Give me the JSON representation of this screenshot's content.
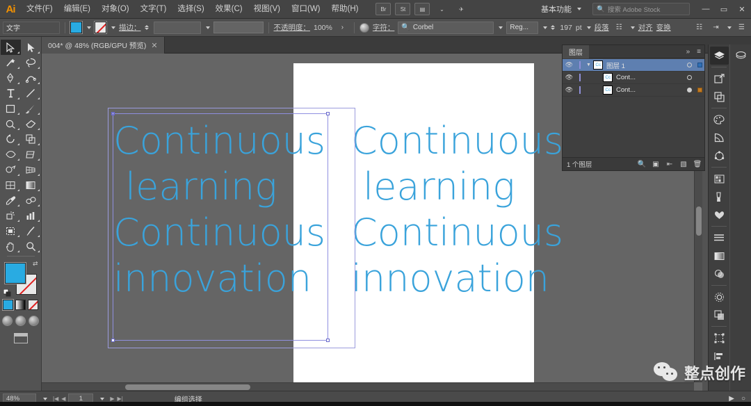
{
  "app": {
    "logo": "Ai",
    "title": "Adobe Illustrator"
  },
  "menubar": {
    "items": [
      {
        "label": "文件(F)"
      },
      {
        "label": "编辑(E)"
      },
      {
        "label": "对象(O)"
      },
      {
        "label": "文字(T)"
      },
      {
        "label": "选择(S)"
      },
      {
        "label": "效果(C)"
      },
      {
        "label": "视图(V)"
      },
      {
        "label": "窗口(W)"
      },
      {
        "label": "帮助(H)"
      }
    ],
    "bridge_icon": "bridge-icon",
    "stock_icon": "St",
    "arrange_icon": "arrange-documents-icon",
    "rocket_icon": "rocket-icon",
    "workspace": "基本功能",
    "search_placeholder": "搜索 Adobe Stock",
    "window_buttons": {
      "minimize": "—",
      "maximize": "▭",
      "close": "✕"
    }
  },
  "controlbar": {
    "object_type": "文字",
    "fill_label": "fill-swatch",
    "stroke_label": "stroke-swatch",
    "stroke_text": "描边：",
    "stroke_weight": "",
    "opacity_label": "不透明度：",
    "opacity_value": "100%",
    "char_label": "字符：",
    "font_family": "Corbel",
    "font_style": "Reg...",
    "font_size": "197",
    "font_size_unit": "pt",
    "paragraph_label": "段落",
    "align_label": "对齐",
    "transform_label": "变换"
  },
  "tabs": {
    "documents": [
      {
        "label": "004* @ 48% (RGB/GPU 预览)",
        "close": "✕",
        "active": true
      }
    ]
  },
  "toolbar": {
    "tools": [
      {
        "name": "selection-tool",
        "active": true
      },
      {
        "name": "direct-selection-tool",
        "active": false
      },
      {
        "name": "magic-wand-tool",
        "active": false
      },
      {
        "name": "lasso-tool",
        "active": false
      },
      {
        "name": "pen-tool",
        "active": false
      },
      {
        "name": "curvature-tool",
        "active": false
      },
      {
        "name": "type-tool",
        "active": false
      },
      {
        "name": "line-segment-tool",
        "active": false
      },
      {
        "name": "rectangle-tool",
        "active": false
      },
      {
        "name": "paintbrush-tool",
        "active": false
      },
      {
        "name": "shaper-tool",
        "active": false
      },
      {
        "name": "eraser-tool",
        "active": false
      },
      {
        "name": "rotate-tool",
        "active": false
      },
      {
        "name": "scale-tool",
        "active": false
      },
      {
        "name": "width-tool",
        "active": false
      },
      {
        "name": "free-transform-tool",
        "active": false
      },
      {
        "name": "shape-builder-tool",
        "active": false
      },
      {
        "name": "perspective-grid-tool",
        "active": false
      },
      {
        "name": "mesh-tool",
        "active": false
      },
      {
        "name": "gradient-tool",
        "active": false
      },
      {
        "name": "eyedropper-tool",
        "active": false
      },
      {
        "name": "blend-tool",
        "active": false
      },
      {
        "name": "symbol-sprayer-tool",
        "active": false
      },
      {
        "name": "column-graph-tool",
        "active": false
      },
      {
        "name": "artboard-tool",
        "active": false
      },
      {
        "name": "slice-tool",
        "active": false
      },
      {
        "name": "hand-tool",
        "active": false
      },
      {
        "name": "zoom-tool",
        "active": false
      }
    ],
    "fill_color": "#29abe2",
    "stroke_color": "none",
    "swatch_modes": [
      "color-swatch",
      "gradient-swatch",
      "none-swatch"
    ],
    "draw_modes": [
      "draw-normal",
      "draw-behind",
      "draw-inside"
    ],
    "screen_mode": "screen-mode-icon"
  },
  "canvas": {
    "artwork_text": "Continuous\n learning\nContinuous\ninnovation",
    "copy_text": "Continuous\n learning\nContinuous\ninnovation",
    "text_color": "#3aa3db",
    "selection_color": "#8f8fe0",
    "artboard_background": "#ffffff",
    "canvas_background": "#656565"
  },
  "layers_panel": {
    "tab_label": "图层",
    "collapse_icon": "»",
    "menu_icon": "≡",
    "rows": [
      {
        "name": "图层 1",
        "thumb": "layer-thumb",
        "selected": true,
        "expanded": true,
        "visible": true,
        "locked": false
      },
      {
        "name": "Cont...",
        "thumb": "text-thumb",
        "selected": false,
        "expanded": false,
        "visible": true,
        "locked": false
      },
      {
        "name": "Cont...",
        "thumb": "text-thumb",
        "selected": false,
        "expanded": false,
        "visible": true,
        "locked": false
      }
    ],
    "footer_count": "1 个图层",
    "footer_icons": [
      "locate-object-icon",
      "make-mask-icon",
      "new-sublayer-icon",
      "new-layer-icon",
      "delete-layer-icon"
    ]
  },
  "dock": {
    "buttons": [
      {
        "name": "layers-panel-icon",
        "active": true
      },
      {
        "name": "libraries-panel-icon",
        "active": false
      },
      {
        "name": "export-panel-icon",
        "active": false
      },
      {
        "name": "artboards-panel-icon",
        "active": false
      },
      {
        "name": "color-panel-icon",
        "active": false
      },
      {
        "name": "color-guide-panel-icon",
        "active": false
      },
      {
        "name": "recolor-artwork-icon",
        "active": false
      },
      {
        "name": "swatches-panel-icon",
        "active": false
      },
      {
        "name": "brushes-panel-icon",
        "active": false
      },
      {
        "name": "symbols-panel-icon",
        "active": false
      },
      {
        "name": "stroke-panel-icon",
        "active": false
      },
      {
        "name": "gradient-panel-icon",
        "active": false
      },
      {
        "name": "transparency-panel-icon",
        "active": false
      },
      {
        "name": "appearance-panel-icon",
        "active": false
      },
      {
        "name": "graphic-styles-panel-icon",
        "active": false
      },
      {
        "name": "transform-panel-icon",
        "active": false
      },
      {
        "name": "align-panel-icon",
        "active": false
      }
    ]
  },
  "statusbar": {
    "zoom": "48%",
    "page_number": "1",
    "status_text": "编组选择",
    "nav_first": "|◀",
    "nav_prev": "◀",
    "nav_next": "▶",
    "nav_last": "▶|"
  },
  "watermark": {
    "text": "整点创作",
    "icon": "wechat-icon"
  }
}
